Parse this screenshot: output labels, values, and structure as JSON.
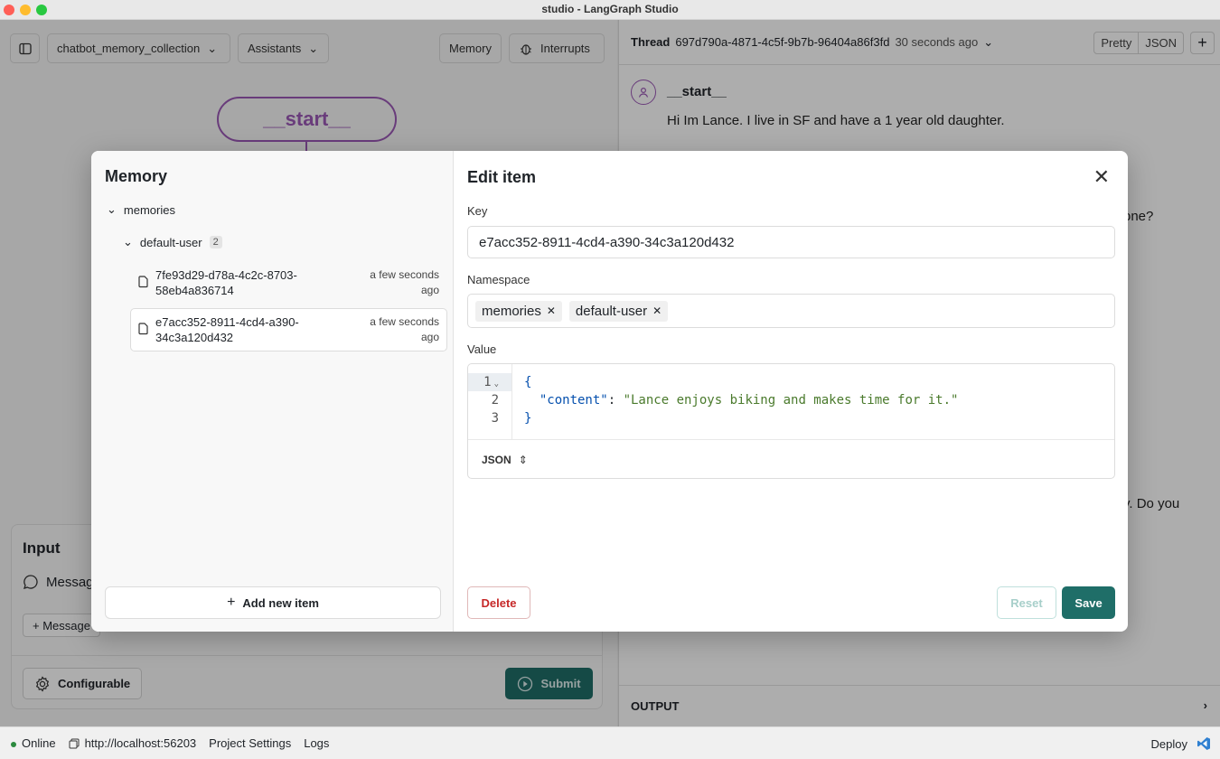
{
  "window": {
    "title": "studio - LangGraph Studio"
  },
  "toolbar": {
    "graph_select": "chatbot_memory_collection",
    "assistants_label": "Assistants",
    "memory_label": "Memory",
    "interrupts_label": "Interrupts"
  },
  "graph": {
    "start_node": "__start__"
  },
  "input_panel": {
    "title": "Input",
    "message_label": "Message",
    "add_message_label": "+ Message",
    "configurable_label": "Configurable",
    "submit_label": "Submit"
  },
  "thread": {
    "label": "Thread",
    "id": "697d790a-4871-4c5f-9b7b-96404a86f3fd",
    "time": "30 seconds ago",
    "pretty_label": "Pretty",
    "json_label": "JSON",
    "node_name": "__start__",
    "message": "Hi Im Lance. I live in SF and have a 1 year old daughter.",
    "partial_1": "one?",
    "partial_2": "y. Do you",
    "output_label": "OUTPUT"
  },
  "status": {
    "online_label": "Online",
    "url": "http://localhost:56203",
    "project_settings": "Project Settings",
    "logs": "Logs",
    "deploy": "Deploy"
  },
  "memory_modal": {
    "title": "Memory",
    "root_namespace": "memories",
    "user_namespace": "default-user",
    "user_count": "2",
    "items": [
      {
        "key_line1": "7fe93d29-d78a-4c2c-8703-",
        "key_line2": "58eb4a836714",
        "time_line1": "a few seconds",
        "time_line2": "ago"
      },
      {
        "key_line1": "e7acc352-8911-4cd4-a390-",
        "key_line2": "34c3a120d432",
        "time_line1": "a few seconds",
        "time_line2": "ago"
      }
    ],
    "add_item_label": "Add new item"
  },
  "edit_item": {
    "title": "Edit item",
    "key_label": "Key",
    "key_value": "e7acc352-8911-4cd4-a390-34c3a120d432",
    "namespace_label": "Namespace",
    "namespace_chips": [
      "memories",
      "default-user"
    ],
    "value_label": "Value",
    "line_numbers": [
      "1",
      "2",
      "3"
    ],
    "code": {
      "open_brace": "{",
      "key": "\"content\"",
      "colon": ": ",
      "value": "\"Lance enjoys biking and makes time for it.\"",
      "close_brace": "}"
    },
    "format_label": "JSON",
    "delete_label": "Delete",
    "reset_label": "Reset",
    "save_label": "Save"
  },
  "colors": {
    "accent": "#1f6e68",
    "node": "#9b59b6",
    "danger": "#c62828"
  }
}
